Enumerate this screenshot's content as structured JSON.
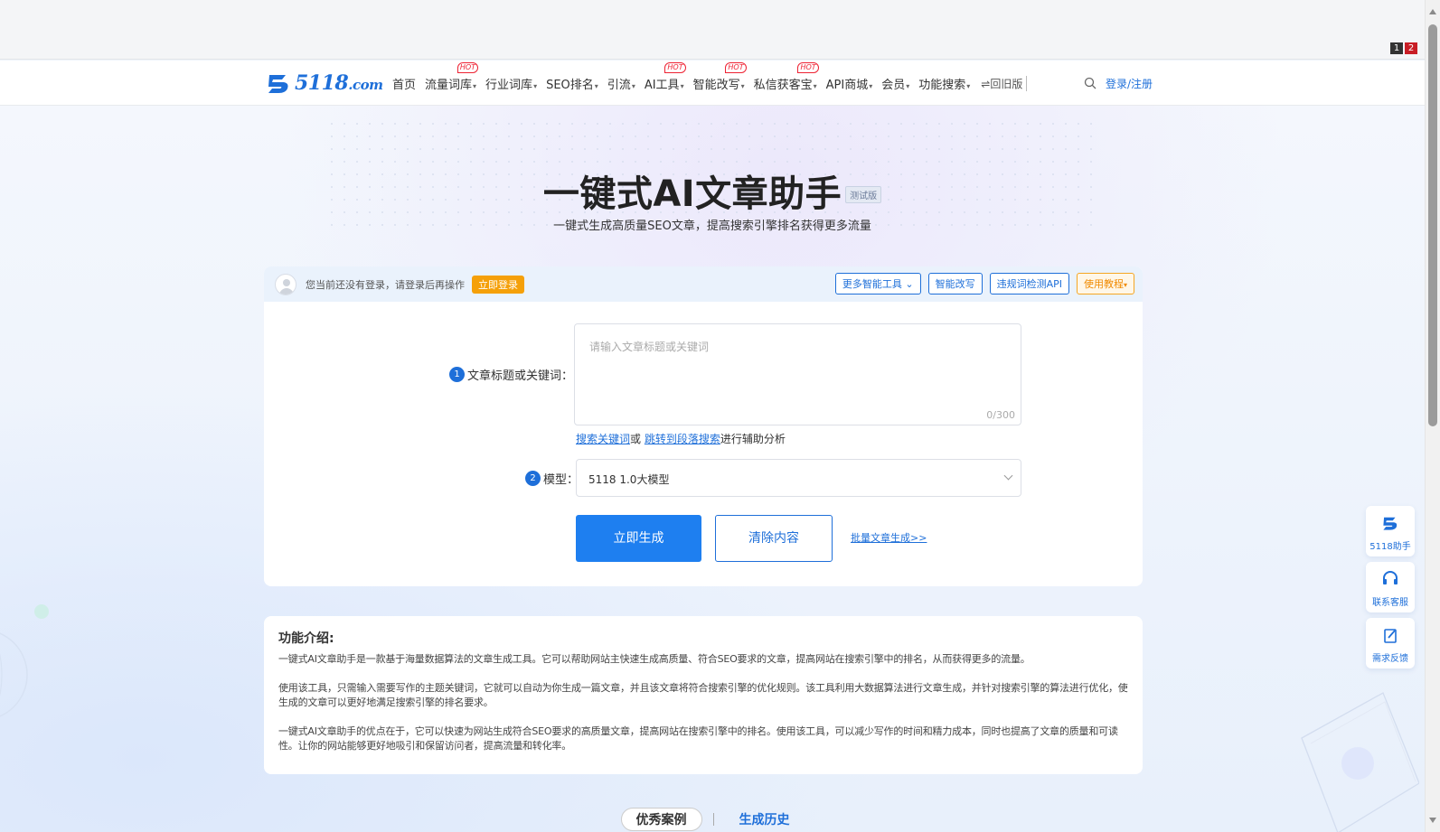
{
  "pager": [
    "1",
    "2"
  ],
  "nav": {
    "logo": "5118",
    "logo_suffix": ".com",
    "items": [
      {
        "label": "首页",
        "caret": false,
        "hot": false
      },
      {
        "label": "流量词库",
        "caret": true,
        "hot": true
      },
      {
        "label": "行业词库",
        "caret": true,
        "hot": false
      },
      {
        "label": "SEO排名",
        "caret": true,
        "hot": false
      },
      {
        "label": "引流",
        "caret": true,
        "hot": false
      },
      {
        "label": "AI工具",
        "caret": true,
        "hot": true
      },
      {
        "label": "智能改写",
        "caret": true,
        "hot": true
      },
      {
        "label": "私信获客宝",
        "caret": true,
        "hot": true
      },
      {
        "label": "API商城",
        "caret": true,
        "hot": false
      },
      {
        "label": "会员",
        "caret": true,
        "hot": false
      },
      {
        "label": "功能搜索",
        "caret": true,
        "hot": false
      }
    ],
    "hot_label": "HOT",
    "old_version": "⇌回旧版",
    "login": "登录/注册"
  },
  "hero": {
    "title": "一键式AI文章助手",
    "badge": "测试版",
    "subtitle": "一键式生成高质量SEO文章，提高搜索引擎排名获得更多流量"
  },
  "card": {
    "login_tip": "您当前还没有登录，请登录后再操作",
    "login_button": "立即登录",
    "head_buttons": {
      "more_tools": "更多智能工具",
      "rewrite": "智能改写",
      "violation_api": "违规词检测API",
      "tutorial": "使用教程"
    },
    "field1": {
      "num": "1",
      "label": "文章标题或关键词：",
      "placeholder": "请输入文章标题或关键词",
      "count": "0/300"
    },
    "assist": {
      "link1": "搜索关键词",
      "mid": "或",
      "link2": "跳转到段落搜索",
      "tail": "进行辅助分析"
    },
    "field2": {
      "num": "2",
      "label": "模型：",
      "value": "5118 1.0大模型"
    },
    "generate": "立即生成",
    "clear": "清除内容",
    "batch": "批量文章生成>>"
  },
  "intro": {
    "title": "功能介绍:",
    "paragraphs": [
      "一键式AI文章助手是一款基于海量数据算法的文章生成工具。它可以帮助网站主快速生成高质量、符合SEO要求的文章，提高网站在搜索引擎中的排名，从而获得更多的流量。",
      "使用该工具，只需输入需要写作的主题关键词，它就可以自动为你生成一篇文章，并且该文章将符合搜索引擎的优化规则。该工具利用大数据算法进行文章生成，并针对搜索引擎的算法进行优化，使生成的文章可以更好地满足搜索引擎的排名要求。",
      "一键式AI文章助手的优点在于，它可以快速为网站生成符合SEO要求的高质量文章，提高网站在搜索引擎中的排名。使用该工具，可以减少写作的时间和精力成本，同时也提高了文章的质量和可读性。让你的网站能够更好地吸引和保留访问者，提高流量和转化率。"
    ]
  },
  "tabs": {
    "cases": "优秀案例",
    "history": "生成历史"
  },
  "floats": {
    "assistant": "5118助手",
    "service": "联系客服",
    "feedback": "需求反馈"
  },
  "colors": {
    "brand": "#1e6fd9",
    "primary_button": "#1e7ff0",
    "login_orange": "#f5a009",
    "hot": "#e23"
  }
}
